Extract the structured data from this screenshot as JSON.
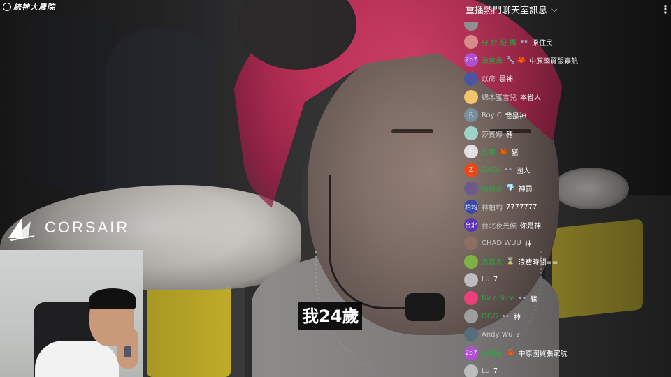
{
  "watermark": {
    "text": "統神大農院"
  },
  "sponsor": {
    "name": "CORSAIR"
  },
  "subtitle": "我24歲",
  "chat": {
    "header": "重播熱門聊天室訊息",
    "messages": [
      {
        "author": "",
        "text": "",
        "color": "#8f8f8f",
        "initial": ""
      },
      {
        "author": "分 於 紀 楊",
        "badge": "👓",
        "text": "原住民",
        "member": true,
        "color": "#d98a8a",
        "initial": ""
      },
      {
        "author": "承憲承",
        "badge": "🔧 🦀",
        "text": "中原國貿張嘉航",
        "member": true,
        "color": "#b04fd1",
        "initial": "2b7"
      },
      {
        "author": "以彥",
        "text": "是神",
        "color": "#4b55a3",
        "initial": ""
      },
      {
        "author": "綿木蜜雪兒",
        "text": "本省人",
        "color": "#f3c66b",
        "initial": ""
      },
      {
        "author": "Roy C",
        "text": "我是神",
        "color": "#78909c",
        "initial": "R"
      },
      {
        "author": "莎賓娜",
        "text": "豬",
        "color": "#9fd3c7",
        "initial": ""
      },
      {
        "author": "廷瑋",
        "badge": "🦀",
        "text": "豬",
        "member": true,
        "color": "#e0e0e0",
        "initial": "♪"
      },
      {
        "author": "ZACK",
        "badge": "👓",
        "text": "國人",
        "member": true,
        "color": "#e64a19",
        "initial": "Z"
      },
      {
        "author": "吳阿禾",
        "badge": "💎",
        "text": "神罰",
        "member": true,
        "color": "#6d5a8c",
        "initial": ""
      },
      {
        "author": "林柏均",
        "text": "7777777",
        "color": "#3949ab",
        "initial": "柏均"
      },
      {
        "author": "台北夜光侯",
        "text": "你是神",
        "color": "#5e35b1",
        "initial": "台北"
      },
      {
        "author": "CHAD WUU",
        "text": "神",
        "color": "#8d6e63",
        "initial": ""
      },
      {
        "author": "呂嘉言",
        "badge": "⌛",
        "text": "浪費時間==",
        "member": true,
        "color": "#7cb342",
        "initial": ""
      },
      {
        "author": "Lu",
        "text": "7",
        "color": "#bdbdbd",
        "initial": ""
      },
      {
        "author": "Nice Nice",
        "badge": "👓",
        "text": "豬",
        "member": true,
        "color": "#ec407a",
        "initial": ""
      },
      {
        "author": "OGG",
        "badge": "👓",
        "text": "神",
        "member": true,
        "color": "#9e9e9e",
        "initial": ""
      },
      {
        "author": "Andy Wu",
        "text": "?",
        "color": "#546e7a",
        "initial": ""
      },
      {
        "author": "承憲承",
        "badge": "🦀",
        "text": "中原國貿張家航",
        "member": true,
        "color": "#b04fd1",
        "initial": "2b7"
      },
      {
        "author": "Lu",
        "text": "7",
        "color": "#bdbdbd",
        "initial": ""
      }
    ]
  }
}
